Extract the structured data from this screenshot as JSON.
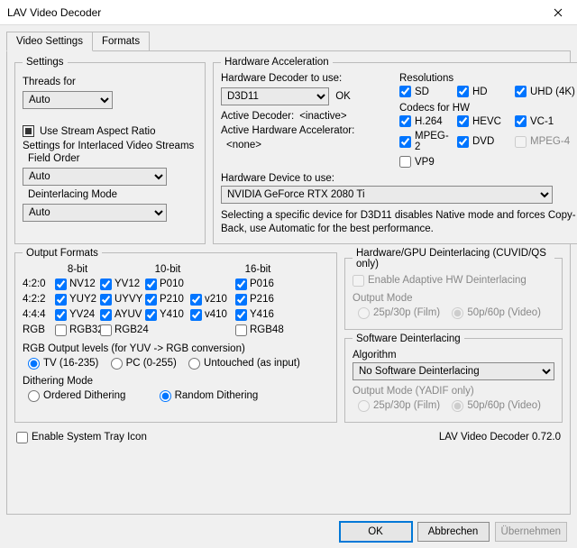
{
  "window": {
    "title": "LAV Video Decoder"
  },
  "tabs": {
    "video": "Video Settings",
    "formats": "Formats"
  },
  "settings": {
    "group": "Settings",
    "threads_label": "Threads for",
    "threads_value": "Auto",
    "use_stream_aspect": "Use Stream Aspect Ratio",
    "interlaced_heading": "Settings for Interlaced Video Streams",
    "field_order_label": "Field Order",
    "field_order_value": "Auto",
    "deint_mode_label": "Deinterlacing Mode",
    "deint_mode_value": "Auto"
  },
  "hw": {
    "group": "Hardware Acceleration",
    "decoder_label": "Hardware Decoder to use:",
    "decoder_value": "D3D11",
    "decoder_ok": "OK",
    "active_decoder_label": "Active Decoder:",
    "active_decoder_value": "<inactive>",
    "active_accel_label": "Active Hardware Accelerator:",
    "active_accel_value": "<none>",
    "device_label": "Hardware Device to use:",
    "device_value": "NVIDIA GeForce RTX 2080 Ti",
    "note": "Selecting a specific device for D3D11 disables Native mode and forces Copy-Back, use Automatic for the best performance.",
    "res_group": "Resolutions",
    "res": {
      "sd": "SD",
      "hd": "HD",
      "uhd": "UHD (4K)"
    },
    "codecs_group": "Codecs for HW",
    "codecs": {
      "h264": "H.264",
      "hevc": "HEVC",
      "vc1": "VC-1",
      "mpeg2": "MPEG-2",
      "dvd": "DVD",
      "mpeg4": "MPEG-4",
      "vp9": "VP9"
    }
  },
  "formats": {
    "group": "Output Formats",
    "cols": {
      "b8": "8-bit",
      "b10": "10-bit",
      "b16": "16-bit"
    },
    "rows": {
      "r420": "4:2:0",
      "r422": "4:2:2",
      "r444": "4:4:4",
      "rgb": "RGB"
    },
    "f": {
      "nv12": "NV12",
      "yv12": "YV12",
      "p010": "P010",
      "p016": "P016",
      "yuy2": "YUY2",
      "uyvy": "UYVY",
      "p210": "P210",
      "v210": "v210",
      "p216": "P216",
      "yv24": "YV24",
      "ayuv": "AYUV",
      "y410": "Y410",
      "v410": "v410",
      "y416": "Y416",
      "rgb32": "RGB32",
      "rgb24": "RGB24",
      "rgb48": "RGB48"
    },
    "rgb_levels_label": "RGB Output levels (for YUV -> RGB conversion)",
    "rgb_levels": {
      "tv": "TV (16-235)",
      "pc": "PC (0-255)",
      "untouched": "Untouched (as input)"
    },
    "dither_label": "Dithering Mode",
    "dither": {
      "ordered": "Ordered Dithering",
      "random": "Random Dithering"
    }
  },
  "hwdeint": {
    "group": "Hardware/GPU Deinterlacing (CUVID/QS only)",
    "enable": "Enable Adaptive HW Deinterlacing",
    "output_mode": "Output Mode",
    "film": "25p/30p (Film)",
    "video": "50p/60p (Video)"
  },
  "swdeint": {
    "group": "Software Deinterlacing",
    "algo_label": "Algorithm",
    "algo_value": "No Software Deinterlacing",
    "output_mode": "Output Mode (YADIF only)",
    "film": "25p/30p (Film)",
    "video": "50p/60p (Video)"
  },
  "tray": "Enable System Tray Icon",
  "version": "LAV Video Decoder 0.72.0",
  "buttons": {
    "ok": "OK",
    "cancel": "Abbrechen",
    "apply": "Übernehmen"
  }
}
